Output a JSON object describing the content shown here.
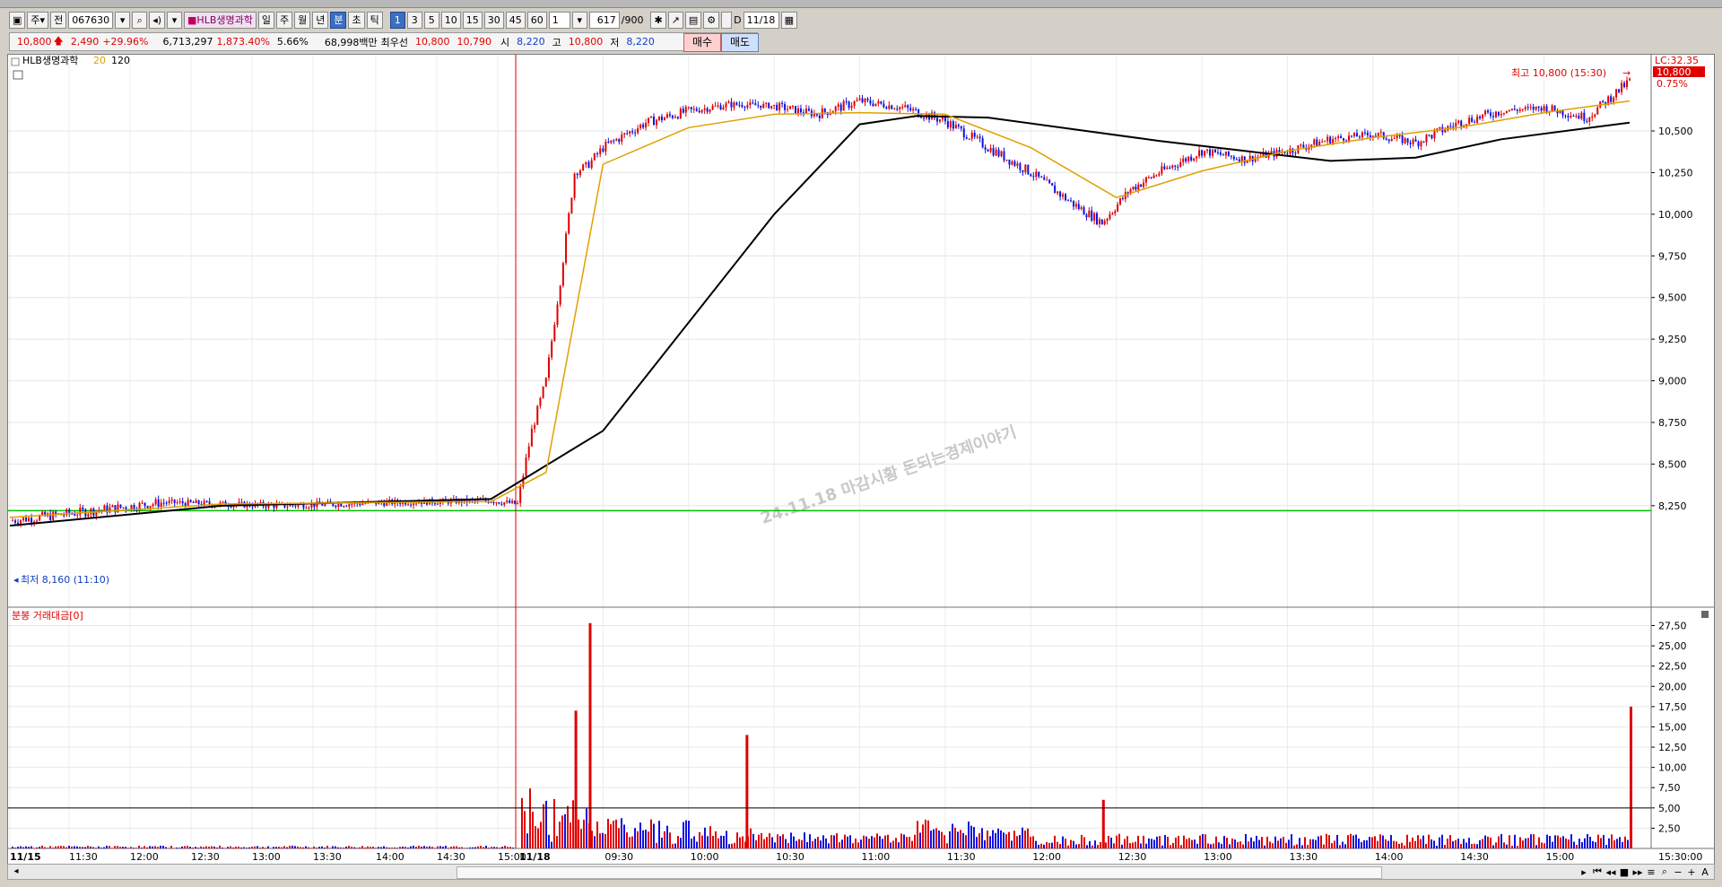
{
  "toolbar": {
    "period_label": "주",
    "prev_label": "전",
    "code": "067630",
    "stock_name": "HLB생명과학",
    "tf_day": "일",
    "tf_week": "주",
    "tf_month": "월",
    "tf_year": "년",
    "tf_min": "분",
    "tf_sec": "초",
    "tf_tick": "틱",
    "intervals": [
      "1",
      "3",
      "5",
      "10",
      "15",
      "30",
      "45",
      "60"
    ],
    "interval_value": "1",
    "count_value": "617",
    "count_total": "/900",
    "d_label": "D",
    "date_value": "11/18"
  },
  "quote": {
    "price": "10,800",
    "change": "2,490",
    "change_pct": "+29.96%",
    "volume": "6,713,297",
    "volume_pct": "1,873.40%",
    "turnover_pct": "5.66%",
    "amount": "68,998백만",
    "best_label": "최우선",
    "best_ask": "10,800",
    "best_bid": "10,790",
    "open_label": "시",
    "open": "8,220",
    "high_label": "고",
    "high": "10,800",
    "low_label": "저",
    "low": "8,220",
    "buy_label": "매수",
    "sell_label": "매도"
  },
  "price_panel": {
    "legend_name": "HLB생명과학",
    "ma20": "20",
    "ma120": "120",
    "lc_label": "LC:32.35",
    "current_tag": "10,800",
    "pct_tag": "0.75%",
    "high_annotation": "최고 10,800 (15:30)",
    "low_annotation": "최저 8,160 (11:10)",
    "watermark": "24.11.18 마감시황 돈되는경제이야기",
    "y_ticks": [
      "10,500",
      "10,250",
      "10,000",
      "9,750",
      "9,500",
      "9,250",
      "9,000",
      "8,750",
      "8,500",
      "8,250"
    ]
  },
  "volume_panel": {
    "title": "분봉 거래대금[0]",
    "y_ticks": [
      "27,50",
      "25,00",
      "22,50",
      "20,00",
      "17,50",
      "15,00",
      "12,50",
      "10,00",
      "7,50",
      "5,00",
      "2,50"
    ]
  },
  "x_axis": {
    "labels": [
      "11/15",
      "11:30",
      "12:00",
      "12:30",
      "13:00",
      "13:30",
      "14:00",
      "14:30",
      "15:00",
      "11/18",
      "09:30",
      "10:00",
      "10:30",
      "11:00",
      "11:30",
      "12:00",
      "12:30",
      "13:00",
      "13:30",
      "14:00",
      "14:30",
      "15:00"
    ],
    "end_label": "15:30:00"
  },
  "colors": {
    "up": "#e00000",
    "down": "#1010e0",
    "ma20": "#e0a000",
    "ma120": "#000000",
    "ref_line": "#00c000",
    "separator": "#e00000"
  },
  "chart_data": {
    "type": "line",
    "title": "",
    "series": [
      {
        "name": "HLB생명과학",
        "x": [
          "11:10",
          "12:30",
          "13:30",
          "14:30",
          "15:20",
          "09:00",
          "09:05",
          "09:10",
          "09:15",
          "09:20",
          "09:25",
          "09:30",
          "09:45",
          "10:00",
          "10:15",
          "10:30",
          "10:45",
          "11:00",
          "11:15",
          "11:30",
          "11:45",
          "12:00",
          "12:15",
          "12:25",
          "12:35",
          "12:45",
          "13:00",
          "13:15",
          "13:30",
          "13:45",
          "14:00",
          "14:15",
          "14:30",
          "14:45",
          "15:00",
          "15:15",
          "15:30"
        ],
        "values": [
          8160,
          8270,
          8250,
          8270,
          8280,
          8260,
          8700,
          9000,
          9600,
          10250,
          10300,
          10400,
          10550,
          10620,
          10660,
          10650,
          10600,
          10680,
          10640,
          10560,
          10400,
          10250,
          10060,
          9950,
          10150,
          10250,
          10380,
          10330,
          10380,
          10450,
          10480,
          10430,
          10550,
          10620,
          10640,
          10580,
          10800
        ]
      },
      {
        "name": "20",
        "x": [
          "11:10",
          "13:00",
          "15:20",
          "09:10",
          "09:30",
          "10:00",
          "10:30",
          "11:00",
          "11:30",
          "12:00",
          "12:30",
          "13:00",
          "13:30",
          "14:00",
          "14:30",
          "15:00",
          "15:30"
        ],
        "values": [
          8180,
          8260,
          8275,
          8450,
          10300,
          10520,
          10600,
          10610,
          10600,
          10400,
          10100,
          10260,
          10380,
          10460,
          10520,
          10610,
          10680
        ]
      },
      {
        "name": "120",
        "x": [
          "11:10",
          "13:00",
          "15:20",
          "09:30",
          "10:00",
          "10:30",
          "11:00",
          "11:20",
          "11:45",
          "12:15",
          "12:45",
          "13:15",
          "13:45",
          "14:15",
          "14:45",
          "15:30"
        ],
        "values": [
          8130,
          8250,
          8290,
          8700,
          9350,
          10000,
          10540,
          10590,
          10580,
          10510,
          10440,
          10380,
          10320,
          10340,
          10450,
          10550
        ]
      }
    ],
    "ylim": [
      8050,
      10850
    ],
    "volume_ylim": [
      0,
      28
    ],
    "volume_highlights": [
      {
        "x": "09:20",
        "value": 17
      },
      {
        "x": "09:25",
        "value": 27.8
      },
      {
        "x": "10:20",
        "value": 14
      },
      {
        "x": "12:25",
        "value": 6
      },
      {
        "x": "15:30",
        "value": 17.5
      }
    ],
    "volume_ref": 5,
    "grid": true
  }
}
